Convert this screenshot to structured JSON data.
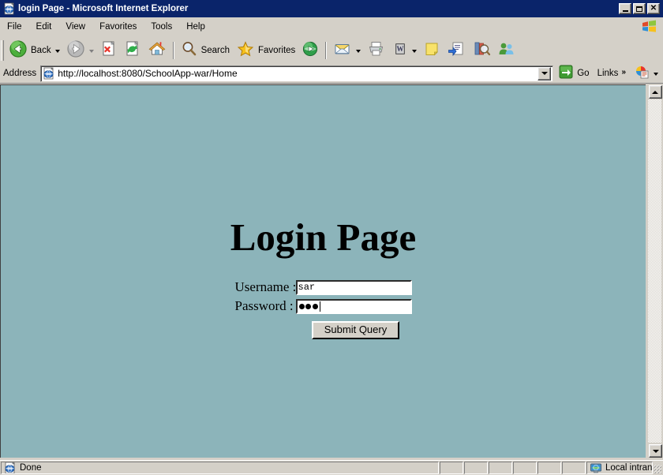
{
  "window": {
    "title": "login Page - Microsoft Internet Explorer",
    "icon": "ie-document-icon",
    "minimize_label": "Minimize",
    "maximize_label": "Maximize",
    "close_label": "Close"
  },
  "menubar": {
    "items": [
      {
        "label": "File"
      },
      {
        "label": "Edit"
      },
      {
        "label": "View"
      },
      {
        "label": "Favorites"
      },
      {
        "label": "Tools"
      },
      {
        "label": "Help"
      }
    ],
    "logo": "windows-flag-icon"
  },
  "toolbar": {
    "back_label": "Back",
    "back_icon": "back-arrow-icon",
    "forward_icon": "forward-arrow-icon",
    "stop_icon": "stop-icon",
    "refresh_icon": "refresh-icon",
    "home_icon": "home-icon",
    "search_label": "Search",
    "search_icon": "magnifier-icon",
    "favorites_label": "Favorites",
    "favorites_icon": "star-icon",
    "media_icon": "media-icon",
    "mail_icon": "mail-icon",
    "print_icon": "printer-icon",
    "edit_icon": "edit-page-icon",
    "note_icon": "yellow-note-icon",
    "discuss_icon": "discuss-icon",
    "research_icon": "research-icon",
    "messenger_icon": "messenger-icon"
  },
  "address": {
    "label": "Address",
    "icon": "ie-document-icon",
    "url": "http://localhost:8080/SchoolApp-war/Home",
    "placeholder": "",
    "dropdown_label": "Address history",
    "go_label": "Go",
    "go_icon": "go-arrow-icon",
    "links_label": "Links",
    "links_chevron": "»",
    "extra_icon": "encarta-icon"
  },
  "page": {
    "background_color": "#8cb4ba",
    "heading": "Login Page",
    "fields": [
      {
        "label": "Username :",
        "name": "username",
        "value": "sar",
        "type": "text",
        "placeholder": ""
      },
      {
        "label": "Password :",
        "name": "password",
        "value": "●●●",
        "masked_char_count": 3,
        "type": "password",
        "placeholder": "",
        "focused": true
      }
    ],
    "submit_label": "Submit Query"
  },
  "scrollbar": {
    "up_label": "Scroll up",
    "down_label": "Scroll down",
    "track_label": "Vertical scroll track"
  },
  "statusbar": {
    "status_text": "Done",
    "status_icon": "ie-document-icon",
    "zone_text": "Local intranet",
    "zone_icon": "local-intranet-icon",
    "empty_panels": 6
  }
}
